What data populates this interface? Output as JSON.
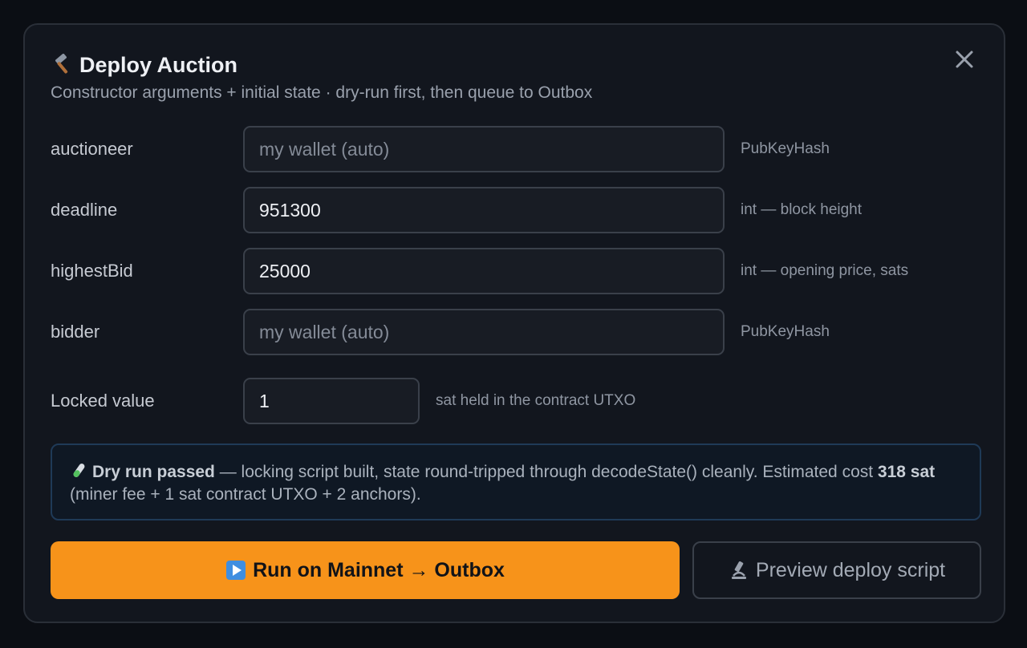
{
  "dialog": {
    "title": "Deploy Auction",
    "subtitle": "Constructor arguments + initial state · dry-run first, then queue to Outbox",
    "title_icon": "hammer-icon",
    "close_icon": "close-icon"
  },
  "fields": [
    {
      "label": "auctioneer",
      "value": "",
      "placeholder": "my wallet (auto)",
      "hint": "PubKeyHash"
    },
    {
      "label": "deadline",
      "value": "951300",
      "placeholder": "",
      "hint": "int — block height"
    },
    {
      "label": "highestBid",
      "value": "25000",
      "placeholder": "",
      "hint": "int — opening price, sats"
    },
    {
      "label": "bidder",
      "value": "",
      "placeholder": "my wallet (auto)",
      "hint": "PubKeyHash"
    }
  ],
  "locked": {
    "label": "Locked value",
    "value": "1",
    "hint": "sat held in the contract UTXO"
  },
  "notice": {
    "icon": "test-tube-icon",
    "status": "Dry run passed",
    "text_a": " — locking script built, state round-tripped through decodeState() cleanly. Estimated cost ",
    "cost": "318 sat",
    "text_b": " (miner fee + 1 sat contract UTXO + 2 anchors)."
  },
  "actions": {
    "run_label": "Run on Mainnet → Outbox",
    "run_icon": "play-icon",
    "preview_label": "Preview deploy script",
    "preview_icon": "microscope-icon"
  },
  "colors": {
    "accent": "#f7931a",
    "background": "#0b0e14",
    "panel": "#12161e"
  }
}
